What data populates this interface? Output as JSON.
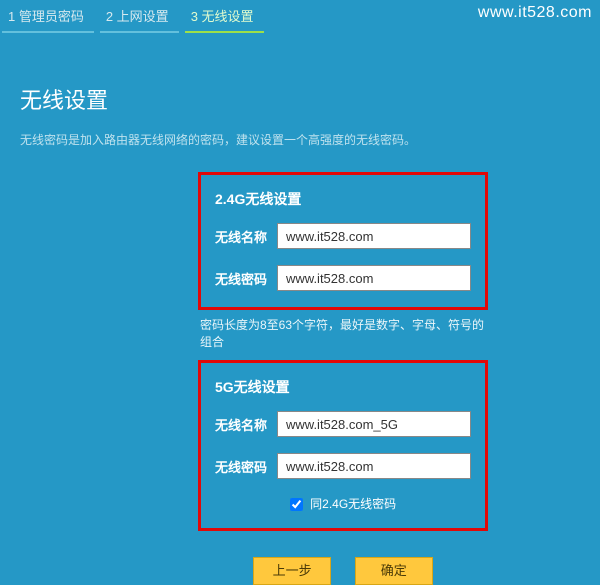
{
  "watermark": "www.it528.com",
  "steps": [
    {
      "label": "1 管理员密码"
    },
    {
      "label": "2 上网设置"
    },
    {
      "label": "3 无线设置"
    }
  ],
  "title": "无线设置",
  "description": "无线密码是加入路由器无线网络的密码，建议设置一个高强度的无线密码。",
  "panel24": {
    "heading": "2.4G无线设置",
    "name_label": "无线名称",
    "name_value": "www.it528.com",
    "pwd_label": "无线密码",
    "pwd_value": "www.it528.com"
  },
  "hint": "密码长度为8至63个字符，最好是数字、字母、符号的组合",
  "panel5": {
    "heading": "5G无线设置",
    "name_label": "无线名称",
    "name_value": "www.it528.com_5G",
    "pwd_label": "无线密码",
    "pwd_value": "www.it528.com",
    "same_label": "同2.4G无线密码"
  },
  "buttons": {
    "prev": "上一步",
    "ok": "确定"
  }
}
